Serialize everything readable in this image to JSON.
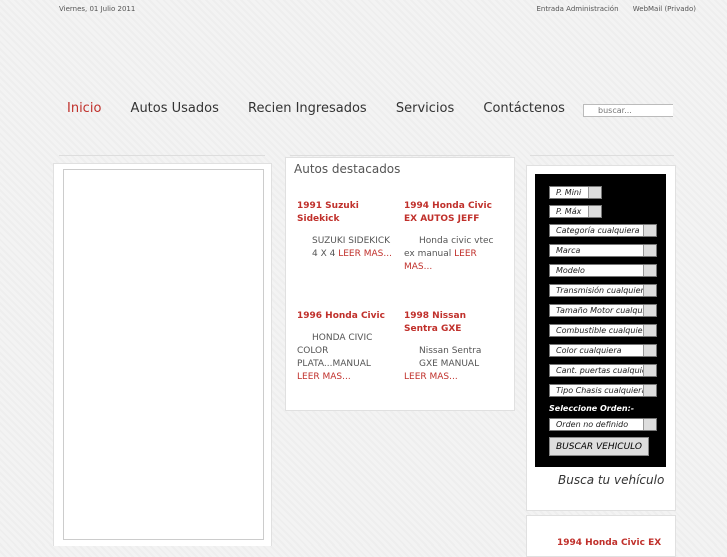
{
  "header": {
    "date": "Viernes, 01 Julio 2011",
    "links": [
      "Entrada Administración",
      "WebMail (Privado)"
    ]
  },
  "nav": {
    "items": [
      "Inicio",
      "Autos Usados",
      "Recien Ingresados",
      "Servicios",
      "Contáctenos"
    ],
    "active": "Inicio"
  },
  "search": {
    "placeholder": "buscar..."
  },
  "featured": {
    "title": "Autos destacados",
    "cars": [
      {
        "title": "1991 Suzuki Sidekick",
        "desc": "SUZUKI SIDEKICK 4 X 4",
        "more": "LEER MAS..."
      },
      {
        "title": "1994 Honda Civic EX AUTOS JEFF",
        "desc": "Honda civic vtec ex manual",
        "more": "LEER MAS..."
      },
      {
        "title": "1996 Honda Civic",
        "desc": "HONDA CIVIC COLOR PLATA...MANUAL",
        "more": "LEER MAS..."
      },
      {
        "title": "1998 Nissan Sentra GXE",
        "desc": "Nissan Sentra GXE MANUAL",
        "more": "LEER MAS..."
      }
    ]
  },
  "vehicle_search": {
    "filters": [
      "P. Mini",
      "P. Máx",
      "Categoría cualquiera",
      "Marca",
      "Modelo",
      "Transmisión cualquiera",
      "Tamaño Motor cualquiera",
      "Combustible cualquiera",
      "Color cualquiera",
      "Cant. puertas cualquiera",
      "Tipo Chasis cualquiera"
    ],
    "order_label": "Seleccione Orden:-",
    "order_value": "Orden no definido",
    "button": "BUSCAR VEHICULO",
    "caption": "Busca tu vehículo"
  },
  "teaser": "1994 Honda Civic EX"
}
